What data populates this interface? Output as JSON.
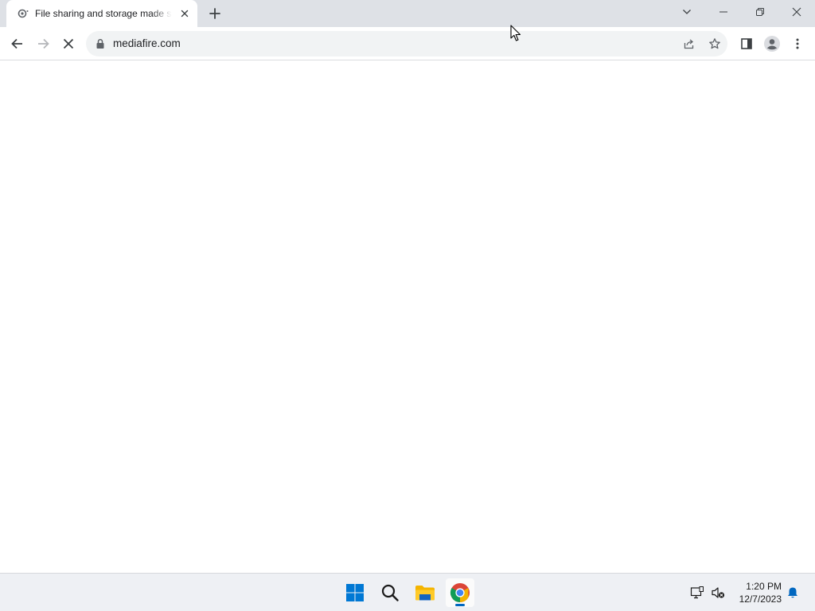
{
  "browser": {
    "tab": {
      "title": "File sharing and storage made simple"
    },
    "address_bar": {
      "url": "mediafire.com"
    }
  },
  "taskbar": {
    "clock": {
      "time": "1:20 PM",
      "date": "12/7/2023"
    }
  },
  "colors": {
    "tabstrip_bg": "#dee1e6",
    "omnibox_bg": "#f1f3f4",
    "taskbar_bg": "#eef0f4",
    "accent": "#0067c0"
  }
}
